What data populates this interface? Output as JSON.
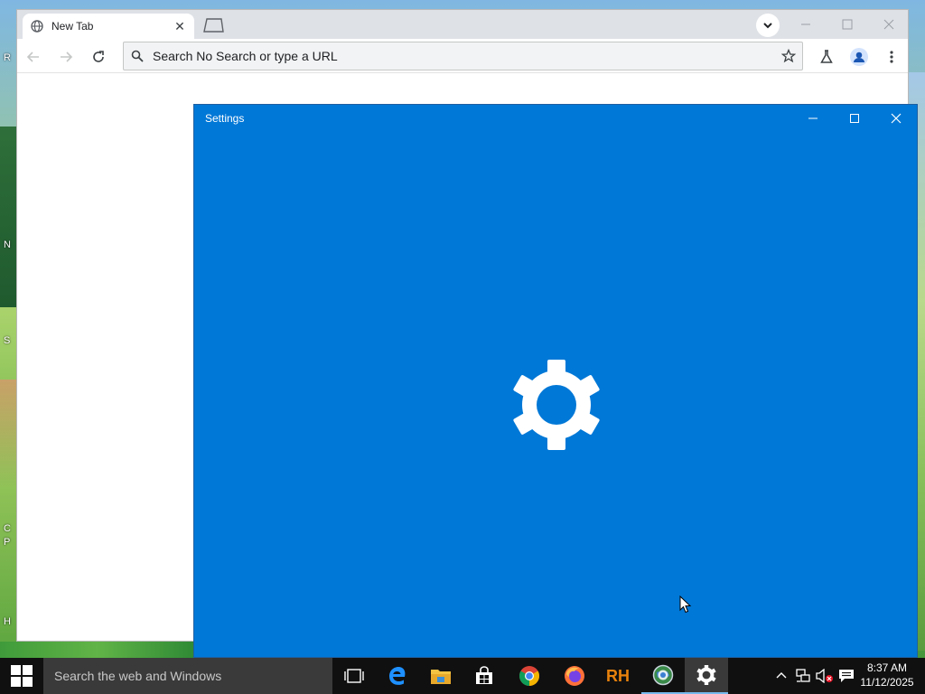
{
  "desktop": {
    "icon_labels": [
      "R",
      "N",
      "S",
      "C",
      "P",
      "H"
    ]
  },
  "browser": {
    "tab_title": "New Tab",
    "tab_close_label": "✕",
    "omnibox_placeholder": "Search No Search or type a URL"
  },
  "settings_window": {
    "title": "Settings"
  },
  "taskbar": {
    "search_placeholder": "Search the web and Windows",
    "clock_time": "8:37 AM",
    "clock_date": "11/12/2025",
    "rh_label": "RH"
  },
  "colors": {
    "settings_bg": "#0078d7",
    "taskbar_bg": "#101010",
    "accent": "#76b9ed"
  }
}
